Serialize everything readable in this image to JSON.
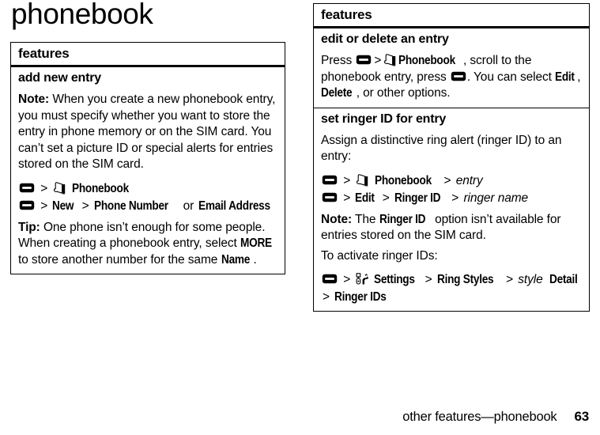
{
  "page": {
    "title": "phonebook",
    "footer_text": "other features—phonebook",
    "page_number": "63"
  },
  "icons": {
    "menu_key": "menu-key-icon",
    "phonebook": "phonebook-icon",
    "settings": "settings-tools-icon"
  },
  "left_table": {
    "header": "features",
    "sections": [
      {
        "heading": "add new entry",
        "note_label": "Note:",
        "note_text": " When you create a new phonebook entry, you must specify whether you want to store the entry in phone memory or on the SIM card. You can’t set a picture ID or special alerts for entries stored on the SIM card.",
        "nav": [
          {
            "parts": [
              "menu-key",
              ">",
              "phonebook-icon",
              "Phonebook"
            ]
          },
          {
            "parts": [
              "menu-key",
              ">",
              "New",
              ">",
              "Phone Number",
              "or",
              "Email Address"
            ]
          }
        ],
        "nav_line1": {
          "sep1": ">",
          "label1": "Phonebook"
        },
        "nav_line2": {
          "sep1": ">",
          "label1": "New",
          "sep2": ">",
          "label2": "Phone Number",
          "conj": "or",
          "label3": "Email Address"
        },
        "tip_label": "Tip:",
        "tip_text_1": " One phone isn’t enough for some people. When creating a phonebook entry, select ",
        "tip_ui_more": "MORE",
        "tip_text_2": " to store another number for the same ",
        "tip_ui_name": "Name",
        "tip_text_3": "."
      }
    ]
  },
  "right_table": {
    "header": "features",
    "sections": [
      {
        "heading": "edit or delete an entry",
        "body_1": "Press ",
        "body_phonebook": "Phonebook",
        "body_2": ", scroll to the phonebook entry, press ",
        "body_3": ". You can select ",
        "body_edit": "Edit",
        "body_4": ", ",
        "body_delete": "Delete",
        "body_5": ", or other options."
      },
      {
        "heading": "set ringer ID for entry",
        "intro": "Assign a distinctive ring alert (ringer ID) to an entry:",
        "nav_line1": {
          "sep1": ">",
          "label1": "Phonebook",
          "sep2": ">",
          "italic1": "entry"
        },
        "nav_line2": {
          "sep1": ">",
          "label1": "Edit",
          "sep2": ">",
          "label2": "Ringer ID",
          "sep3": ">",
          "italic1": "ringer name"
        },
        "note_label": "Note:",
        "note_text_1": " The ",
        "note_ui": "Ringer ID",
        "note_text_2": " option isn’t available for entries stored on the SIM card.",
        "activate_text": "To activate ringer IDs:",
        "nav_line3": {
          "sep1": ">",
          "label1": "Settings",
          "sep2": ">",
          "label2": "Ring Styles",
          "sep3": ">",
          "italic1": "style",
          "label3": "Detail"
        },
        "nav_line4": {
          "sep1": ">",
          "label1": "Ringer IDs"
        }
      }
    ]
  },
  "colors": {
    "ink": "#000000",
    "paper": "#ffffff"
  }
}
